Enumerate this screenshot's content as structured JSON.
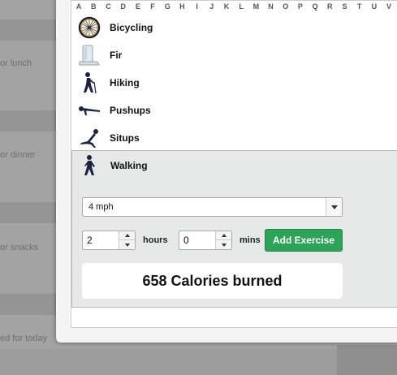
{
  "background": {
    "labels": [
      "or lunch",
      "or dinner",
      "or snacks",
      "ed for today"
    ]
  },
  "alphabet": [
    "A",
    "B",
    "C",
    "D",
    "E",
    "F",
    "G",
    "H",
    "I",
    "J",
    "K",
    "L",
    "M",
    "N",
    "O",
    "P",
    "Q",
    "R",
    "S",
    "T",
    "U",
    "V"
  ],
  "exercises": [
    {
      "label": "Bicycling",
      "icon": "bicycle-wheel-icon"
    },
    {
      "label": "Fir",
      "icon": "wii-fit-icon"
    },
    {
      "label": "Hiking",
      "icon": "hiker-icon"
    },
    {
      "label": "Pushups",
      "icon": "pushup-icon"
    },
    {
      "label": "Situps",
      "icon": "situp-icon"
    }
  ],
  "selected": {
    "label": "Walking",
    "icon": "walker-icon",
    "speed": "4 mph",
    "hours": "2",
    "hours_label": "hours",
    "mins": "0",
    "mins_label": "mins",
    "add_button": "Add Exercise",
    "result": "658 Calories burned"
  },
  "colors": {
    "accent_button": "#2da35a"
  }
}
